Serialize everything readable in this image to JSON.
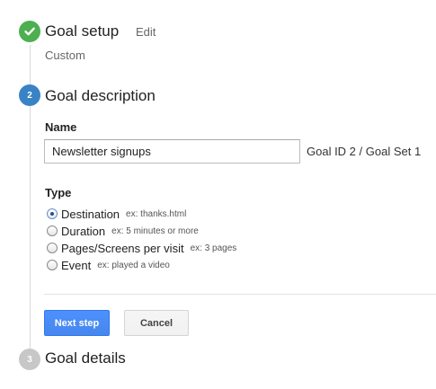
{
  "steps": {
    "setup": {
      "title": "Goal setup",
      "edit_label": "Edit",
      "summary": "Custom",
      "icon": "check-icon"
    },
    "description": {
      "number": "2",
      "title": "Goal description",
      "name_label": "Name",
      "name_value": "Newsletter signups",
      "goal_id_text": "Goal ID 2 / Goal Set 1",
      "type_label": "Type",
      "types": [
        {
          "label": "Destination",
          "example": "ex: thanks.html",
          "selected": true
        },
        {
          "label": "Duration",
          "example": "ex: 5 minutes or more",
          "selected": false
        },
        {
          "label": "Pages/Screens per visit",
          "example": "ex: 3 pages",
          "selected": false
        },
        {
          "label": "Event",
          "example": "ex: played a video",
          "selected": false
        }
      ],
      "next_label": "Next step",
      "cancel_label": "Cancel"
    },
    "details": {
      "number": "3",
      "title": "Goal details"
    }
  },
  "colors": {
    "done": "#4caf50",
    "active": "#3a82c6",
    "pending": "#c7c7c7",
    "primary_button": "#4d90fe"
  }
}
